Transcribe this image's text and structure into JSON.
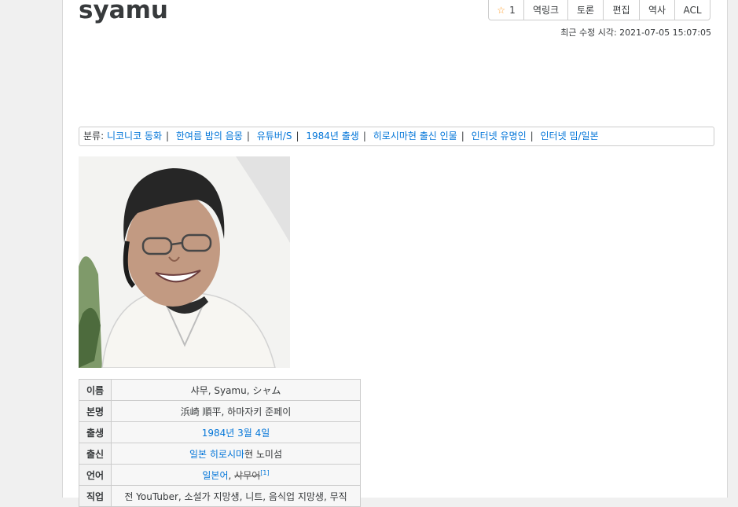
{
  "title": "syamu",
  "toolbar": {
    "star_count": "1",
    "backlinks": "역링크",
    "discuss": "토론",
    "edit": "편집",
    "history": "역사",
    "acl": "ACL"
  },
  "last_edited": "최근 수정 시각: 2021-07-05 15:07:05",
  "categories": {
    "label": "분류:",
    "items": [
      "니코니코 동화",
      "한여름 밤의 음몽",
      "유튜버/S",
      "1984년 출생",
      "히로시마현 출신 인물",
      "인터넷 유명인",
      "인터넷 밈/일본"
    ]
  },
  "infobox": {
    "name": {
      "key": "이름",
      "value": "샤무, Syamu, シャム"
    },
    "real_name": {
      "key": "본명",
      "value": "浜崎 順平, 하마자키 준페이"
    },
    "birth": {
      "key": "출생",
      "value": "1984년 3월 4일"
    },
    "origin": {
      "key": "출신",
      "link": "일본 히로시마",
      "rest": "현 노미섬"
    },
    "language": {
      "key": "언어",
      "link": "일본어",
      "comma": ",",
      "strike": "샤무어",
      "ref": "[1]"
    },
    "job": {
      "key": "직업",
      "value": "전 YouTuber, 소설가 지망생, 니트, 음식업 지망생, 무직"
    }
  },
  "colors": {
    "link": "#0275d8",
    "star": "#ff9f2f",
    "text": "#373a3c"
  }
}
